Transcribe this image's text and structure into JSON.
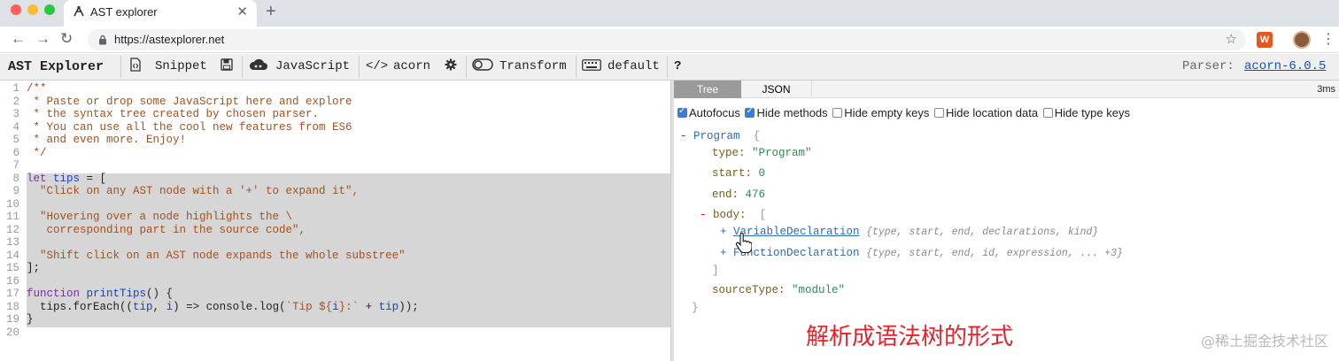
{
  "browser": {
    "tab_title": "AST explorer",
    "tab_close": "✕",
    "new_tab": "+",
    "url": "https://astexplorer.net",
    "back": "←",
    "forward": "→",
    "reload": "↻",
    "bookmark": "☆",
    "menu": "⋮",
    "traffic_colors": [
      "#ff5f57",
      "#febc2e",
      "#28c840"
    ]
  },
  "toolbar": {
    "brand": "AST Explorer",
    "snippet": "Snippet",
    "language": "JavaScript",
    "parser_name": "acorn",
    "transform": "Transform",
    "keymap": "default",
    "help": "?",
    "parser_label": "Parser:",
    "parser_version": "acorn-6.0.5"
  },
  "editor": {
    "lines": [
      {
        "n": "1",
        "t": "/**",
        "c": "comment"
      },
      {
        "n": "2",
        "t": " * Paste or drop some JavaScript here and explore",
        "c": "comment"
      },
      {
        "n": "3",
        "t": " * the syntax tree created by chosen parser.",
        "c": "comment"
      },
      {
        "n": "4",
        "t": " * You can use all the cool new features from ES6",
        "c": "comment"
      },
      {
        "n": "5",
        "t": " * and even more. Enjoy!",
        "c": "comment"
      },
      {
        "n": "6",
        "t": " */",
        "c": "comment"
      },
      {
        "n": "7",
        "t": "",
        "c": "plain"
      },
      {
        "n": "8",
        "t": "",
        "c": "plain"
      },
      {
        "n": "9",
        "t": "  \"Click on any AST node with a '+' to expand it\",",
        "c": "str"
      },
      {
        "n": "10",
        "t": "",
        "c": "plain"
      },
      {
        "n": "11",
        "t": "  \"Hovering over a node highlights the \\",
        "c": "str"
      },
      {
        "n": "12",
        "t": "   corresponding part in the source code\",",
        "c": "str"
      },
      {
        "n": "13",
        "t": "",
        "c": "plain"
      },
      {
        "n": "14",
        "t": "  \"Shift click on an AST node expands the whole substree\"",
        "c": "str"
      },
      {
        "n": "15",
        "t": "];",
        "c": "plain"
      },
      {
        "n": "16",
        "t": "",
        "c": "plain"
      },
      {
        "n": "17",
        "t": "",
        "c": "plain"
      },
      {
        "n": "18",
        "t": "",
        "c": "plain"
      },
      {
        "n": "19",
        "t": "}",
        "c": "plain"
      },
      {
        "n": "20",
        "t": "",
        "c": "plain"
      }
    ],
    "line8": {
      "kw": "let",
      "name": " tips",
      "rest": " = ["
    },
    "line17": {
      "kw": "function",
      "name": " printTips",
      "rest": "() {"
    },
    "line18": {
      "a": "  tips.forEach((",
      "b": "tip",
      "c": ", ",
      "d": "i",
      "e": ") => console.log(",
      "f": "`Tip ${",
      "g": "i",
      "h": "}:`",
      "i": " + ",
      "j": "tip",
      "k": "));"
    }
  },
  "output": {
    "tabs": [
      "Tree",
      "JSON"
    ],
    "timing": "3ms",
    "options": [
      {
        "label": "Autofocus",
        "checked": true
      },
      {
        "label": "Hide methods",
        "checked": true
      },
      {
        "label": "Hide empty keys",
        "checked": false
      },
      {
        "label": "Hide location data",
        "checked": false
      },
      {
        "label": "Hide type keys",
        "checked": false
      }
    ],
    "tree": {
      "root_toggle": "-",
      "root_type": "Program",
      "root_open": "{",
      "type_key": "type:",
      "type_val": "\"Program\"",
      "start_key": "start:",
      "start_val": "0",
      "end_key": "end:",
      "end_val": "476",
      "body_toggle": "-",
      "body_key": "body:",
      "body_open": "[",
      "node1_toggle": "+",
      "node1_type": "VariableDeclaration",
      "node1_hint": "{type, start, end, declarations, kind}",
      "node2_toggle": "+",
      "node2_type": "FunctionDeclaration",
      "node2_hint": "{type, start, end, id, expression, ... +3}",
      "body_close": "]",
      "source_key": "sourceType:",
      "source_val": "\"module\"",
      "root_close": "}"
    }
  },
  "caption": "解析成语法树的形式",
  "watermark": "@稀土掘金技术社区"
}
